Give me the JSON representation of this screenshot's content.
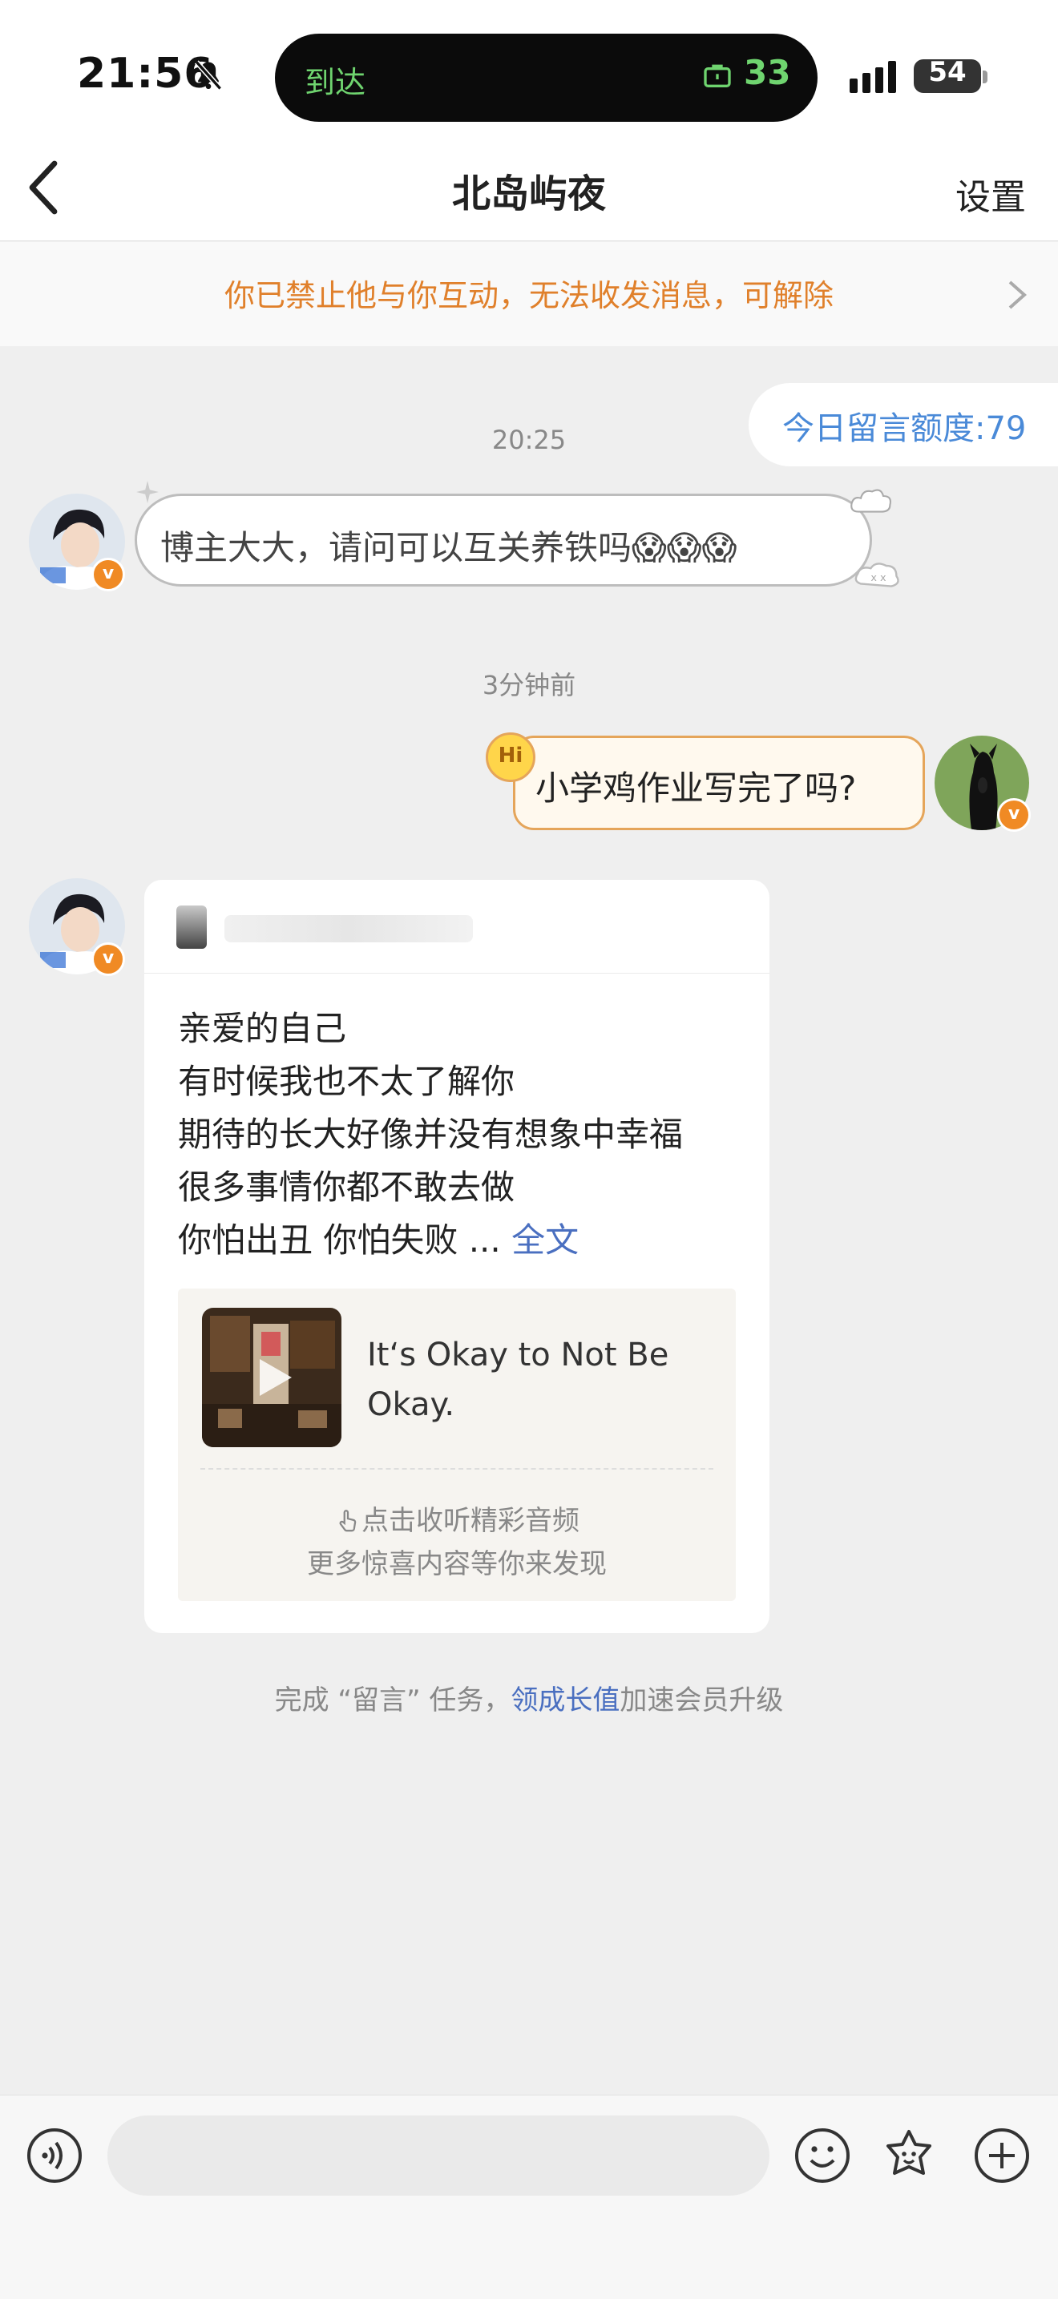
{
  "status_bar": {
    "time": "21:56",
    "island_label": "到达",
    "island_count": "33",
    "battery": "54"
  },
  "nav": {
    "title": "北岛屿夜",
    "settings": "设置"
  },
  "notice": {
    "text": "你已禁止他与你互动，无法收发消息，可解除"
  },
  "quota": {
    "text": "今日留言额度:79"
  },
  "messages": {
    "ts1": "20:25",
    "left1_text": "博主大大，请问可以互关养铁吗😱😱😱",
    "ts2": "3分钟前",
    "right1_text": "小学鸡作业写完了吗?",
    "hi_badge": "Hi",
    "card": {
      "lines": [
        "亲爱的自己",
        "有时候我也不太了解你",
        "期待的长大好像并没有想象中幸福",
        "很多事情你都不敢去做"
      ],
      "last_line": "你怕出丑 你怕失败 ...",
      "more": "全文",
      "music_title": "It‘s Okay to Not Be Okay.",
      "hint1": "点击收听精彩音频",
      "hint2": "更多惊喜内容等你来发现"
    }
  },
  "task": {
    "prefix": "完成 “留言” 任务，",
    "link": "领成长值",
    "suffix": "加速会员升级"
  },
  "colors": {
    "accent_orange": "#e0802b",
    "link_blue": "#4a6fc0",
    "island_green": "#6fd46f"
  }
}
